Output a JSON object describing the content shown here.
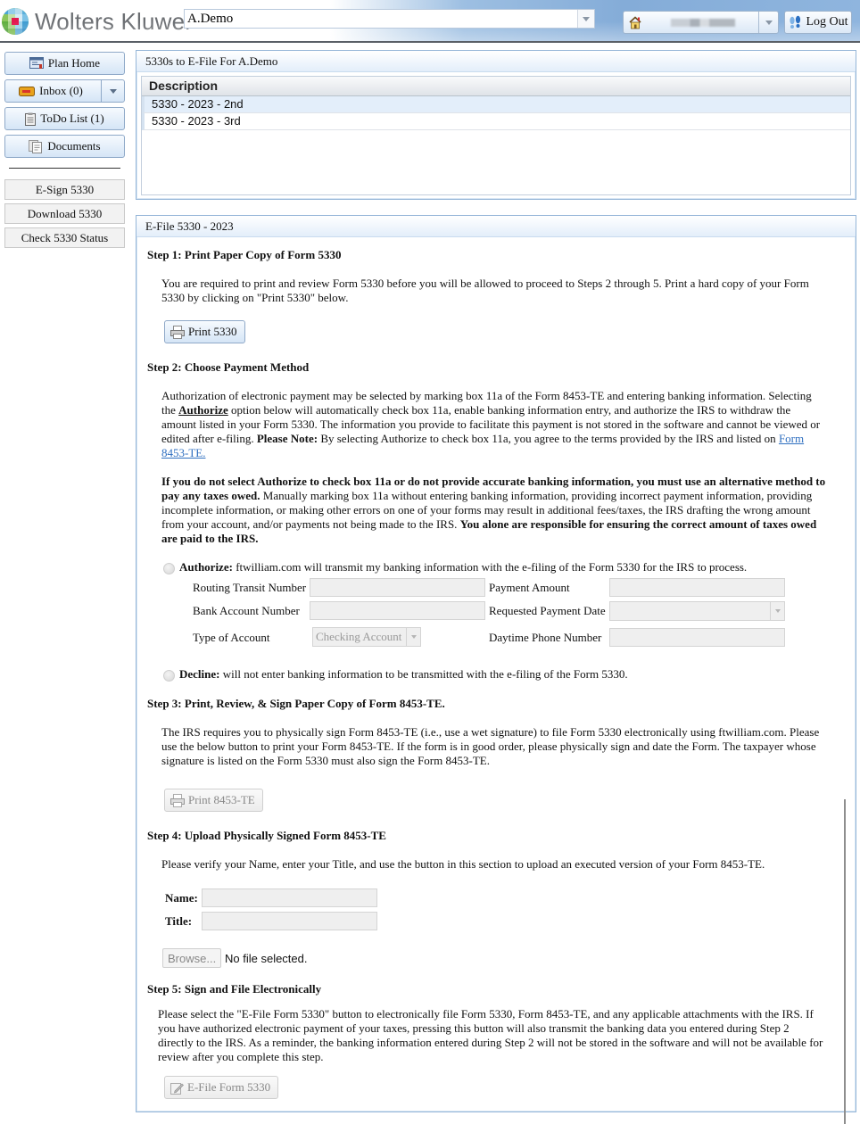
{
  "header": {
    "brand": "Wolters Kluwer",
    "plan_select": {
      "value": "A.Demo"
    },
    "user_menu": {
      "value": "[redacted user]"
    },
    "logout_label": "Log Out"
  },
  "sidebar": {
    "nav": [
      {
        "label": "Plan Home",
        "icon": "plan-home-icon"
      },
      {
        "label": "Inbox (0)",
        "icon": "inbox-icon"
      },
      {
        "label": "ToDo List (1)",
        "icon": "clipboard-icon"
      },
      {
        "label": "Documents",
        "icon": "documents-icon"
      }
    ],
    "actions": [
      {
        "label": "E-Sign 5330"
      },
      {
        "label": "Download 5330"
      },
      {
        "label": "Check 5330 Status"
      }
    ]
  },
  "list_panel": {
    "title": "5330s to E-File For A.Demo",
    "columns": [
      "Description"
    ],
    "rows": [
      {
        "description": "5330 - 2023 - 2nd",
        "selected": true
      },
      {
        "description": "5330 - 2023 - 3rd",
        "selected": false
      }
    ]
  },
  "efile_panel": {
    "title": "E-File 5330 - 2023",
    "step1": {
      "title": "Step 1: Print Paper Copy of Form 5330",
      "text": "You are required to print and review Form 5330 before you will be allowed to proceed to Steps 2 through 5. Print a hard copy of your Form 5330 by clicking on \"Print 5330\" below.",
      "button": "Print 5330"
    },
    "step2": {
      "title": "Step 2: Choose Payment Method",
      "p1_a": "Authorization of electronic payment may be selected by marking box 11a of the Form 8453-TE and entering banking information. Selecting the ",
      "p1_authorize": "Authorize",
      "p1_b": " option below will automatically check box 11a, enable banking information entry, and authorize the IRS to withdraw the amount listed in your Form 5330. The information you provide to facilitate this payment is not stored in the software and cannot be viewed or edited after e-filing. ",
      "p1_note_label": "Please Note:",
      "p1_c": " By selecting Authorize to check box 11a, you agree to the terms provided by the IRS and listed on ",
      "p1_link": "Form 8453-TE.",
      "p2_bold1": "If you do not select Authorize to check box 11a or do not provide accurate banking information, you must use an alternative method to pay any taxes owed.",
      "p2_text": " Manually marking box 11a without entering banking information, providing incorrect payment information, providing incomplete information, or making other errors on one of your forms may result in additional fees/taxes, the IRS drafting the wrong amount from your account, and/or payments not being made to the IRS. ",
      "p2_bold2": "You alone are responsible for ensuring the correct amount of taxes owed are paid to the IRS.",
      "authorize_label": "Authorize:",
      "authorize_text": " ftwilliam.com will transmit my banking information with the e-filing of the Form 5330 for the IRS to process.",
      "fields": {
        "routing": {
          "label": "Routing Transit Number",
          "value": ""
        },
        "account": {
          "label": "Bank Account Number",
          "value": ""
        },
        "type": {
          "label": "Type of Account",
          "value": "Checking Account"
        },
        "amount": {
          "label": "Payment Amount",
          "value": ""
        },
        "date": {
          "label": "Requested Payment Date",
          "value": ""
        },
        "phone": {
          "label": "Daytime Phone Number",
          "value": ""
        }
      },
      "decline_label": "Decline:",
      "decline_text": " will not enter banking information to be transmitted with the e-filing of the Form 5330."
    },
    "step3": {
      "title": "Step 3: Print, Review, & Sign Paper Copy of Form 8453-TE.",
      "text": "The IRS requires you to physically sign Form 8453-TE (i.e., use a wet signature) to file Form 5330 electronically using ftwilliam.com. Please use the below button to print your Form 8453-TE. If the form is in good order, please physically sign and date the Form. The taxpayer whose signature is listed on the Form 5330 must also sign the Form 8453-TE.",
      "button": "Print 8453-TE"
    },
    "step4": {
      "title": "Step 4: Upload Physically Signed Form 8453-TE",
      "text": "Please verify your Name, enter your Title, and use the button in this section to upload an executed version of your Form 8453-TE.",
      "name_label": "Name:",
      "name_value": "",
      "title_label": "Title:",
      "title_value": "",
      "browse_label": "Browse...",
      "file_status": "No file selected."
    },
    "step5": {
      "title": "Step 5: Sign and File Electronically",
      "text": "Please select the \"E-File Form 5330\" button to electronically file Form 5330, Form 8453-TE, and any applicable attachments with the IRS. If you have authorized electronic payment of your taxes, pressing this button will also transmit the banking data you entered during Step 2 directly to the IRS. As a reminder, the banking information entered during Step 2 will not be stored in the software and will not be available for review after you complete this step.",
      "button": "E-File Form 5330"
    }
  }
}
